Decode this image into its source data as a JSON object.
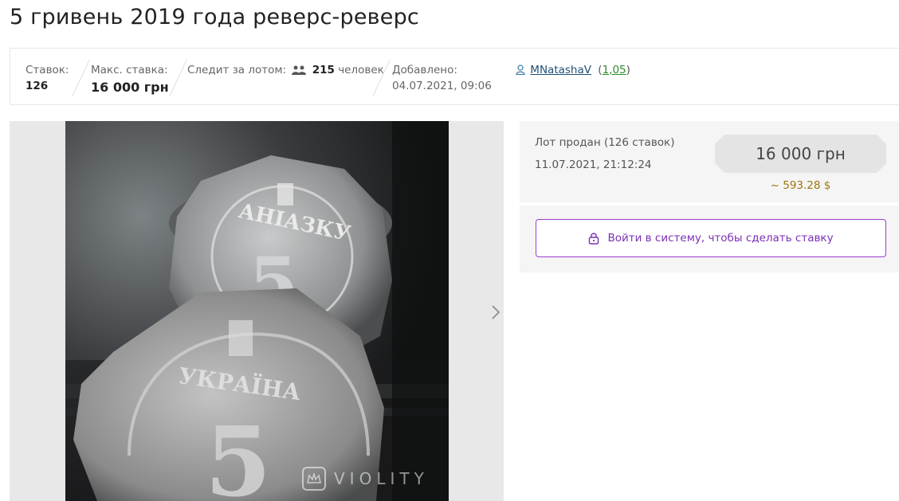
{
  "lot": {
    "title": "5 гривень 2019 года реверс-реверс"
  },
  "info": {
    "bids_label": "Ставок:",
    "bids_value": "126",
    "max_bid_label": "Макс. ставка:",
    "max_bid_value": "16 000 грн",
    "followers_label": "Следит за лотом:",
    "followers_count": "215",
    "followers_unit": "человек",
    "added_label": "Добавлено:",
    "added_value": "04.07.2021, 09:06",
    "seller_name": "MNatashaV",
    "seller_rating_open": "(",
    "seller_rating": "1,05",
    "seller_rating_close": ")"
  },
  "gallery": {
    "watermark": "VIOLITY",
    "next_icon": "chevron-right-icon"
  },
  "sale": {
    "status": "Лот продан (126 ставок)",
    "date": "11.07.2021, 21:12:24",
    "price": "16 000 грн",
    "price_usd": "~ 593.28 $"
  },
  "login": {
    "label": "Войти в систему, чтобы сделать ставку",
    "icon": "lock-icon"
  },
  "colors": {
    "accent": "#7b2fb5",
    "usd": "#a0760a",
    "rating": "#2e8b2e",
    "link": "#1f4f75"
  }
}
